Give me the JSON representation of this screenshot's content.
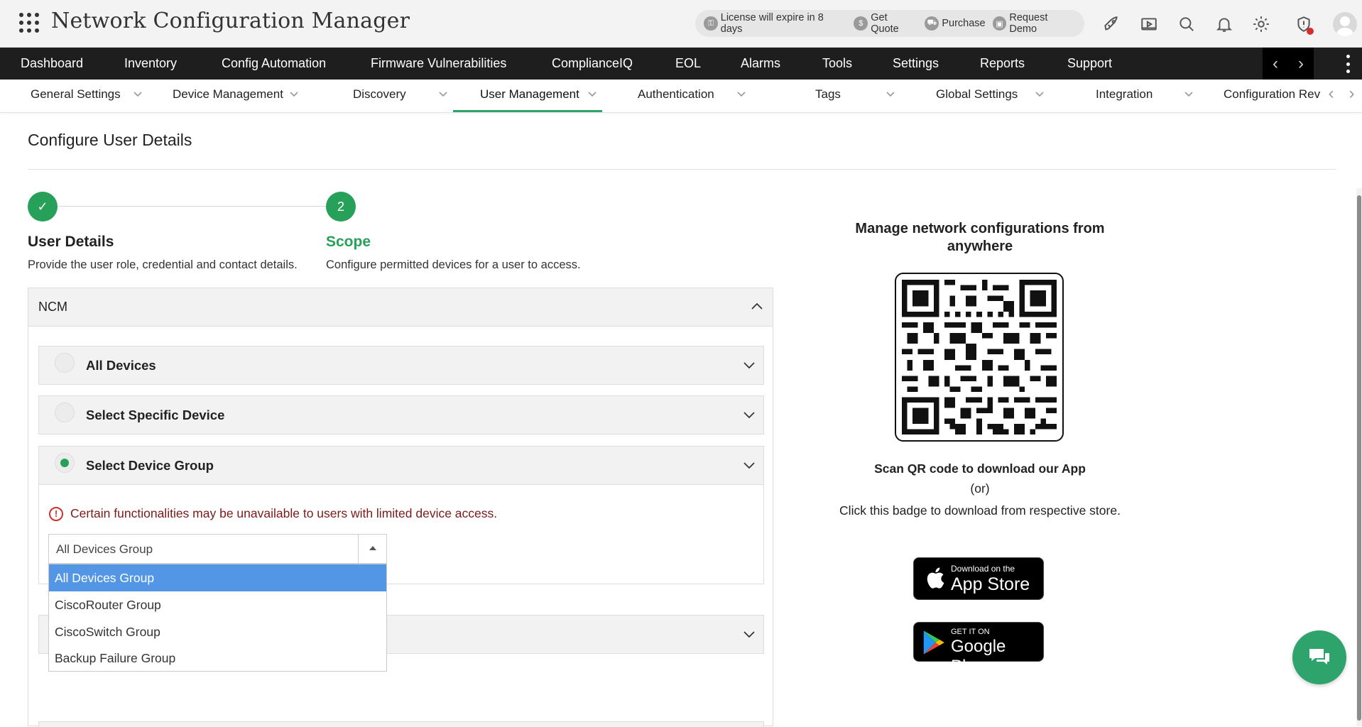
{
  "app": {
    "title": "Network Configuration Manager",
    "license_text": "License will expire in 8 days",
    "get_quote": "Get Quote",
    "purchase": "Purchase",
    "request_demo": "Request Demo"
  },
  "main_nav": [
    "Dashboard",
    "Inventory",
    "Config Automation",
    "Firmware Vulnerabilities",
    "ComplianceIQ",
    "EOL",
    "Alarms",
    "Tools",
    "Settings",
    "Reports",
    "Support"
  ],
  "sub_nav": [
    "General Settings",
    "Device Management",
    "Discovery",
    "User Management",
    "Authentication",
    "Tags",
    "Global Settings",
    "Integration",
    "Configuration Rev"
  ],
  "page": {
    "title": "Configure User Details",
    "steps": [
      {
        "marker": "✓",
        "title": "User Details",
        "desc": "Provide the user role, credential and contact details."
      },
      {
        "marker": "2",
        "title": "Scope",
        "desc": "Configure permitted devices for a user to access."
      }
    ],
    "ncm_label": "NCM",
    "options": [
      "All Devices",
      "Select Specific Device",
      "Select Device Group"
    ],
    "warning": "Certain functionalities may be unavailable to users with limited device access.",
    "group_select": {
      "value": "All Devices Group",
      "options": [
        "All Devices Group",
        "CiscoRouter Group",
        "CiscoSwitch Group",
        "Backup Failure Group"
      ]
    }
  },
  "promo": {
    "title": "Manage network configurations from anywhere",
    "scan": "Scan QR code to download our App",
    "or": "(or)",
    "badge_text": "Click this badge to download from respective store.",
    "app_store_small": "Download on the",
    "app_store_big": "App Store",
    "google_small": "GET IT ON",
    "google_big": "Google Play"
  },
  "colors": {
    "accent": "#2ea36b",
    "nav_bg": "#1e1e1e",
    "selected": "#5396e6",
    "warning": "#d32f2f"
  }
}
